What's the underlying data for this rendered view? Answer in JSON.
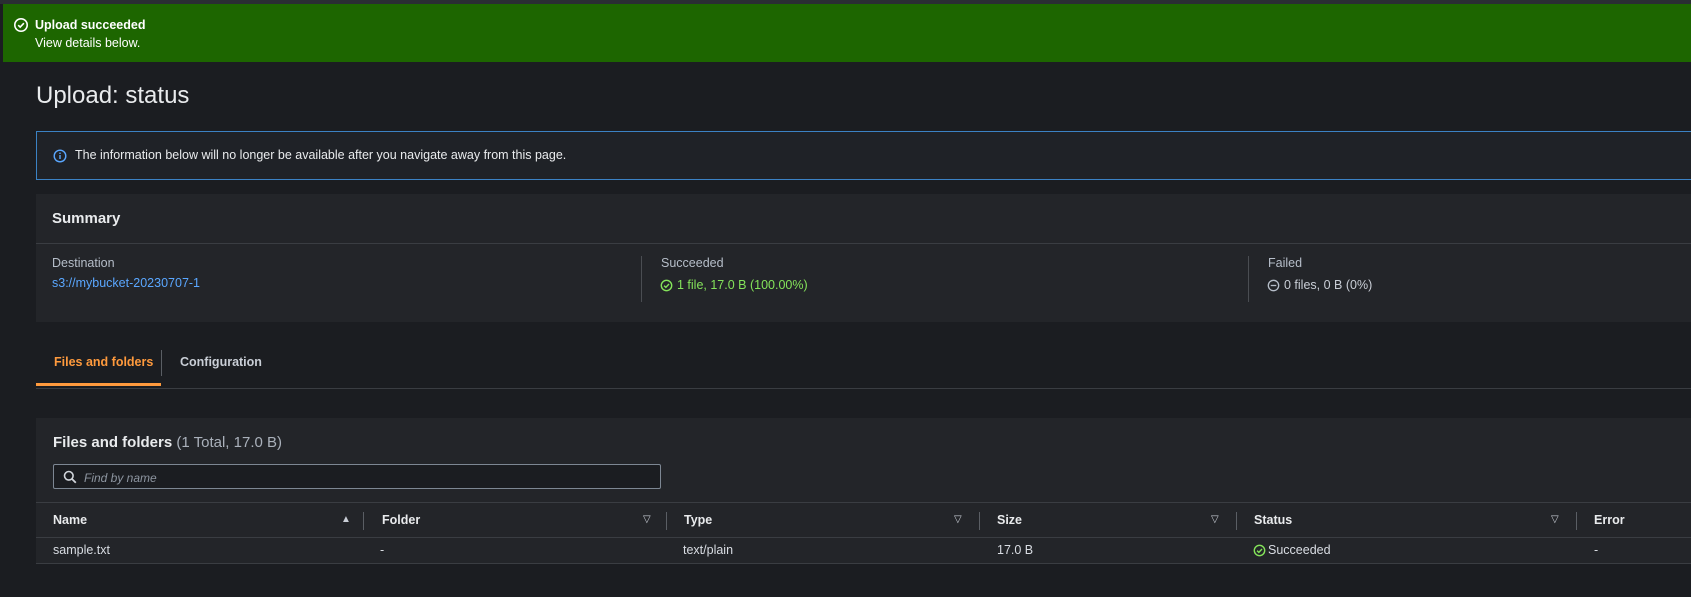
{
  "flash": {
    "title": "Upload succeeded",
    "message": "View details below.",
    "color": "#1d6600",
    "icon": "check-circle-icon"
  },
  "page": {
    "title": "Upload: status"
  },
  "info_alert": {
    "icon": "info-icon",
    "text": "The information below will no longer be available after you navigate away from this page."
  },
  "summary": {
    "title": "Summary",
    "destination": {
      "label": "Destination",
      "value": "s3://mybucket-20230707-1"
    },
    "succeeded": {
      "label": "Succeeded",
      "value": "1 file, 17.0 B (100.00%)",
      "icon": "check-circle-icon"
    },
    "failed": {
      "label": "Failed",
      "value": "0 files, 0 B (0%)",
      "icon": "minus-circle-icon"
    }
  },
  "tabs": [
    {
      "label": "Files and folders",
      "active": true
    },
    {
      "label": "Configuration",
      "active": false
    }
  ],
  "files": {
    "title": "Files and folders",
    "count": "(1 Total, 17.0 B)",
    "search_placeholder": "Find by name",
    "columns": [
      "Name",
      "Folder",
      "Type",
      "Size",
      "Status",
      "Error"
    ],
    "rows": [
      {
        "name": "sample.txt",
        "folder": "-",
        "type": "text/plain",
        "size": "17.0 B",
        "status": "Succeeded",
        "error": "-"
      }
    ]
  },
  "colors": {
    "accent": "#ff9a3d",
    "link": "#5aa7ff",
    "success": "#84e35a",
    "info_border": "#3b82c4"
  }
}
